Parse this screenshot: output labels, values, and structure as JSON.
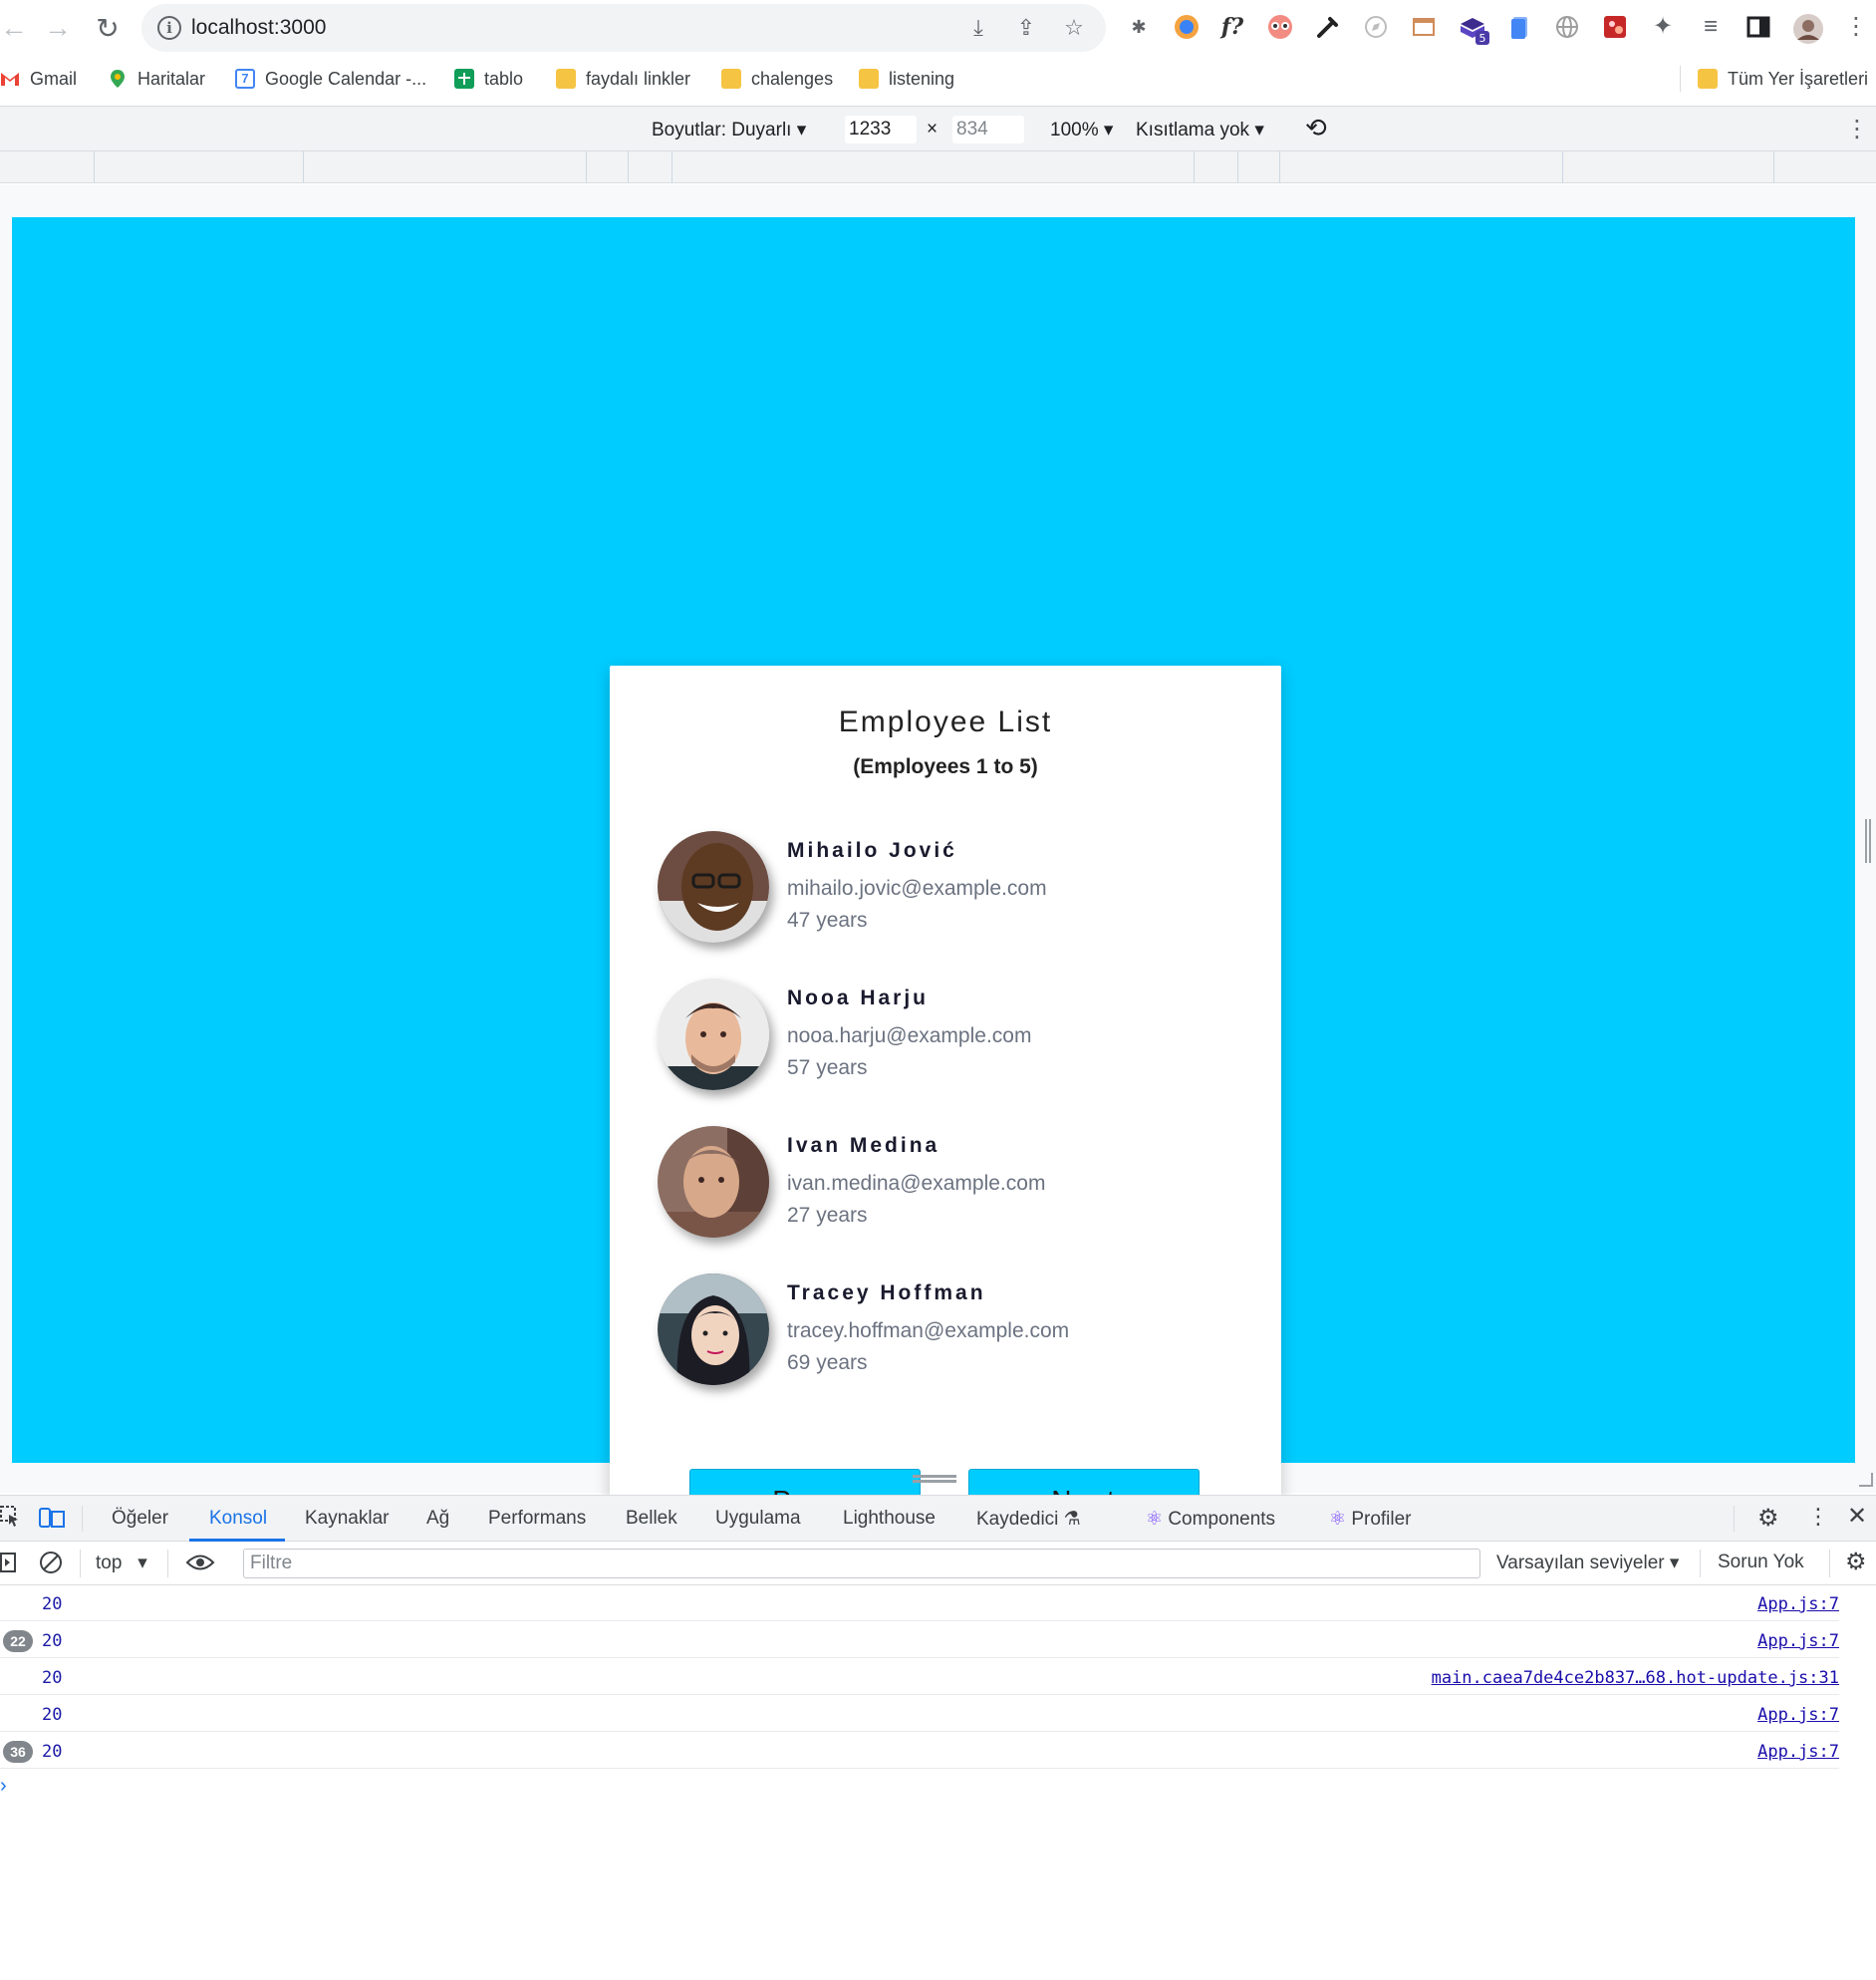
{
  "browser": {
    "url": "localhost:3000",
    "nav_icons": [
      "back-arrow-icon",
      "forward-arrow-icon",
      "reload-icon"
    ],
    "extension_icons": [
      "bug-icon",
      "translate-icon",
      "font-icon",
      "eyes-icon",
      "eyedropper-icon",
      "compass-icon",
      "window-icon",
      "extension-badge-icon",
      "clipboard-icon",
      "globe-icon",
      "photo-icon",
      "puzzle-icon",
      "queue-icon",
      "sidepanel-icon",
      "profile-avatar-icon",
      "more-icon"
    ],
    "font_ext_label": "f?",
    "ext_badge": "5"
  },
  "bookmarks": {
    "items": [
      {
        "label": "Gmail",
        "icon": "gmail-icon"
      },
      {
        "label": "Haritalar",
        "icon": "maps-pin-icon"
      },
      {
        "label": "Google Calendar -...",
        "icon": "calendar-icon"
      },
      {
        "label": "tablo",
        "icon": "sheets-icon"
      },
      {
        "label": "faydalı linkler",
        "icon": "folder-icon"
      },
      {
        "label": "chalenges",
        "icon": "folder-icon"
      },
      {
        "label": "listening",
        "icon": "folder-icon"
      }
    ],
    "all_bookmarks": "Tüm Yer İşaretleri",
    "calendar_day": "7"
  },
  "device_toolbar": {
    "dimensions_label": "Boyutlar: Duyarlı",
    "width": "1233",
    "times": "×",
    "height": "834",
    "zoom": "100%",
    "throttle": "Kısıtlama yok"
  },
  "app": {
    "background_color": "#00ccff",
    "title": "Employee List",
    "subtitle": "(Employees 1 to 5)",
    "employees": [
      {
        "name": "Mihailo Jović",
        "email": "mihailo.jovic@example.com",
        "age": "47 years"
      },
      {
        "name": "Nooa Harju",
        "email": "nooa.harju@example.com",
        "age": "57 years"
      },
      {
        "name": "Ivan Medina",
        "email": "ivan.medina@example.com",
        "age": "27 years"
      },
      {
        "name": "Tracey Hoffman",
        "email": "tracey.hoffman@example.com",
        "age": "69 years"
      }
    ],
    "prev_label": "Prev",
    "next_label": "Next"
  },
  "devtools": {
    "tabs": [
      "Öğeler",
      "Konsol",
      "Kaynaklar",
      "Ağ",
      "Performans",
      "Bellek",
      "Uygulama",
      "Lighthouse",
      "Kaydedici",
      "Components",
      "Profiler"
    ],
    "active_tab": "Konsol",
    "context": "top",
    "filter_placeholder": "Filtre",
    "levels": "Varsayılan seviyeler",
    "issues": "Sorun Yok",
    "logs": [
      {
        "badge": "",
        "value": "20",
        "source": "App.js:7"
      },
      {
        "badge": "22",
        "value": "20",
        "source": "App.js:7"
      },
      {
        "badge": "",
        "value": "20",
        "source": "main.caea7de4ce2b837…68.hot-update.js:31"
      },
      {
        "badge": "",
        "value": "20",
        "source": "App.js:7"
      },
      {
        "badge": "36",
        "value": "20",
        "source": "App.js:7"
      }
    ],
    "prompt": "›"
  }
}
